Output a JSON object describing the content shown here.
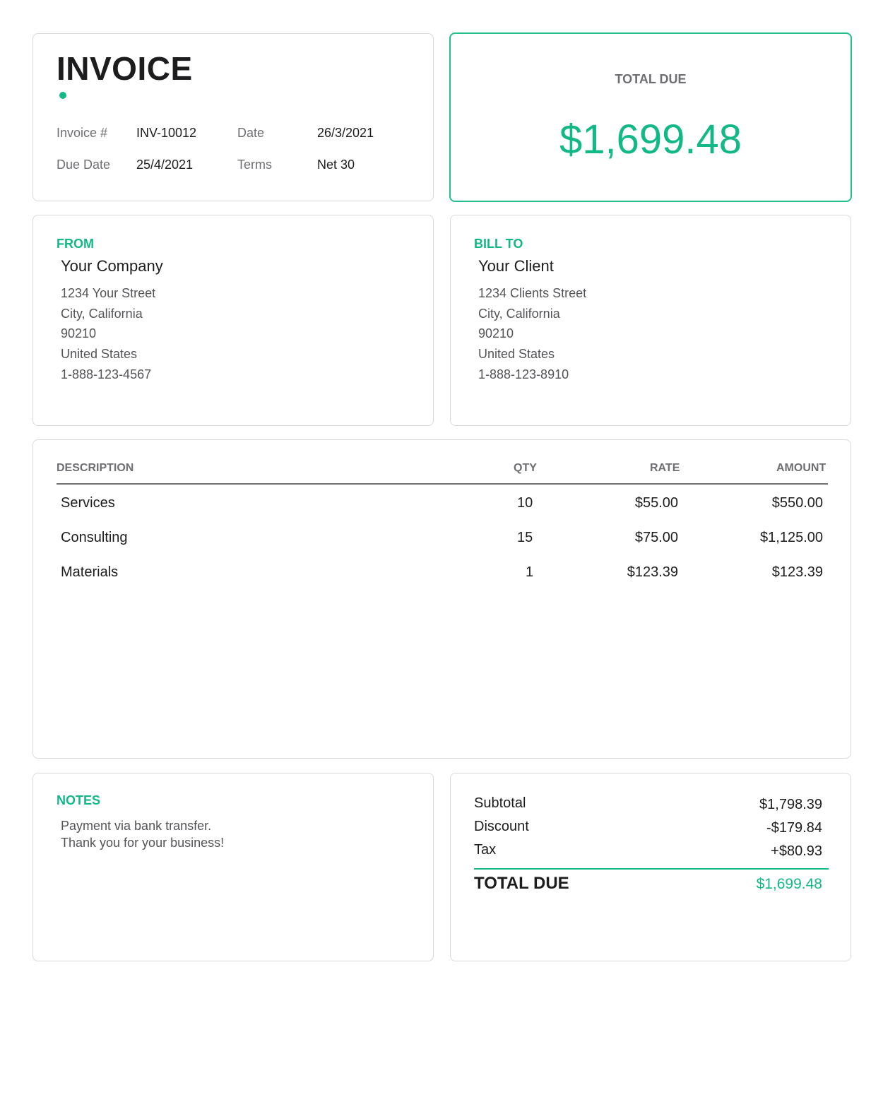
{
  "header": {
    "title": "INVOICE",
    "invoice_no_label": "Invoice #",
    "invoice_no": "INV-10012",
    "date_label": "Date",
    "date": "26/3/2021",
    "due_date_label": "Due Date",
    "due_date": "25/4/2021",
    "terms_label": "Terms",
    "terms": "Net 30"
  },
  "total_box": {
    "label": "TOTAL DUE",
    "amount": "$1,699.48"
  },
  "from": {
    "label": "FROM",
    "name": "Your Company",
    "lines": [
      "1234 Your Street",
      "City, California",
      "90210",
      "United States",
      "1-888-123-4567"
    ]
  },
  "bill_to": {
    "label": "BILL TO",
    "name": "Your Client",
    "lines": [
      "1234 Clients Street",
      "City, California",
      "90210",
      "United States",
      "1-888-123-8910"
    ]
  },
  "items": {
    "columns": [
      "DESCRIPTION",
      "QTY",
      "RATE",
      "AMOUNT"
    ],
    "rows": [
      {
        "description": "Services",
        "qty": "10",
        "rate": "$55.00",
        "amount": "$550.00"
      },
      {
        "description": "Consulting",
        "qty": "15",
        "rate": "$75.00",
        "amount": "$1,125.00"
      },
      {
        "description": "Materials",
        "qty": "1",
        "rate": "$123.39",
        "amount": "$123.39"
      }
    ]
  },
  "notes": {
    "label": "NOTES",
    "lines": [
      "Payment via bank transfer.",
      "Thank you for your business!"
    ]
  },
  "summary": {
    "subtotal_label": "Subtotal",
    "subtotal": "$1,798.39",
    "discount_label": "Discount",
    "discount": "-$179.84",
    "tax_label": "Tax",
    "tax": "+$80.93",
    "total_label": "TOTAL DUE",
    "total": "$1,699.48"
  },
  "colors": {
    "accent": "#12b886",
    "border": "#d9d9dc",
    "muted_text": "#6e6e73"
  }
}
